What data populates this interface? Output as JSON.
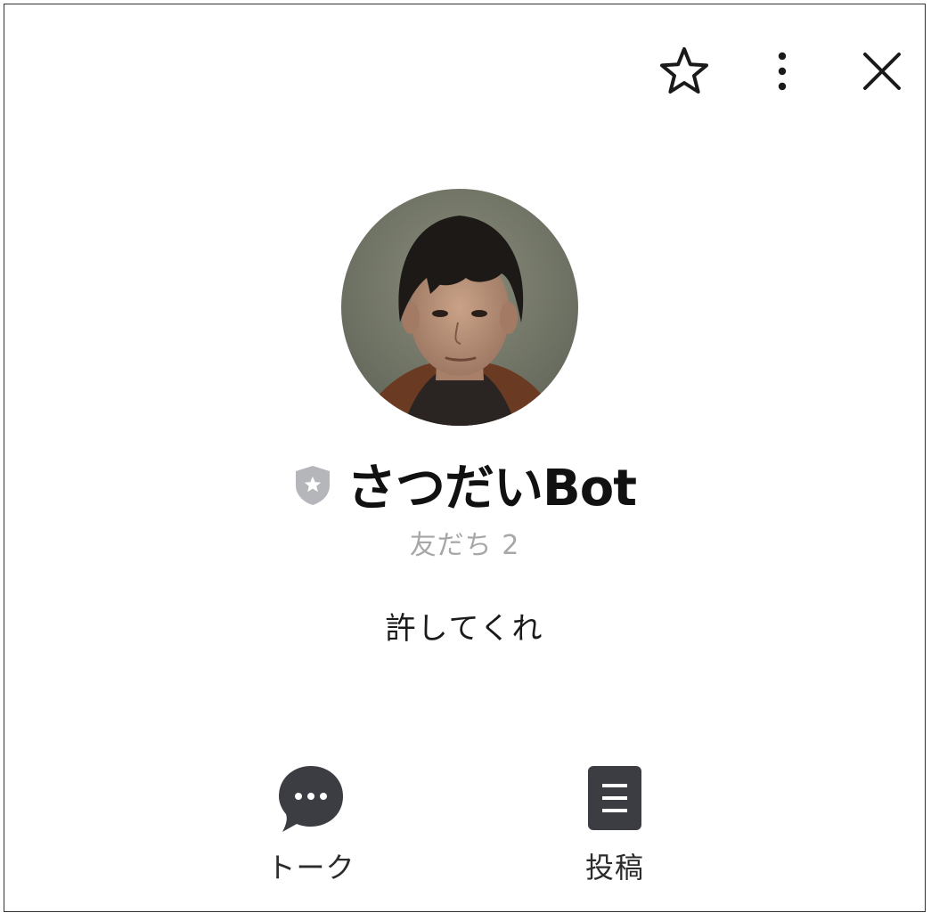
{
  "header": {
    "actions": [
      {
        "icon": "star-outline-icon",
        "label": ""
      },
      {
        "icon": "more-vertical-icon",
        "label": ""
      },
      {
        "icon": "close-icon",
        "label": ""
      }
    ]
  },
  "profile": {
    "avatar_icon": "profile-photo",
    "badge_icon": "official-shield-star-icon",
    "badge_color": "#b4b6ba",
    "name": "さつだいBot",
    "friends": "友だち 2",
    "status_message": "許してくれ"
  },
  "actions": {
    "talk": {
      "icon": "chat-bubble-icon",
      "label": "トーク"
    },
    "post": {
      "icon": "post-document-icon",
      "label": "投稿"
    }
  },
  "colors": {
    "icon_dark": "#3c3d43",
    "text_dark": "#111111",
    "text_muted": "#a7a7a7"
  }
}
